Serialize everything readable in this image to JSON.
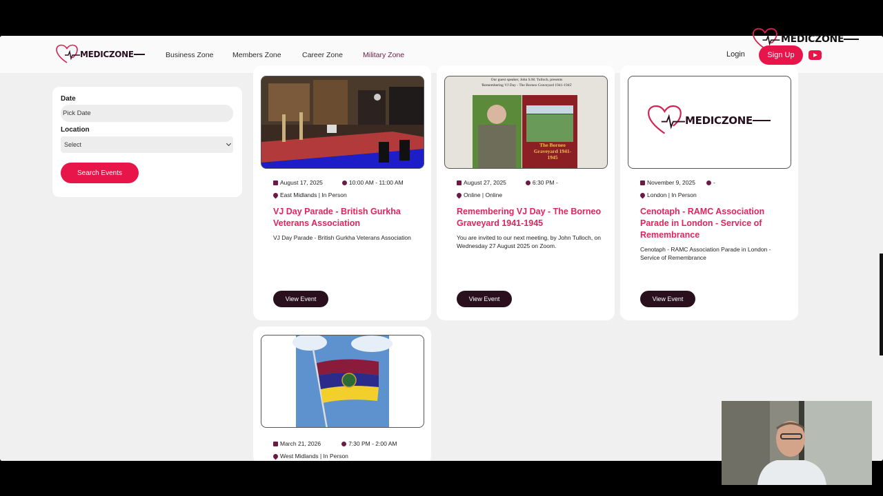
{
  "brand": {
    "name": "MEDICZONE"
  },
  "nav": {
    "items": [
      {
        "label": "Business Zone"
      },
      {
        "label": "Members Zone"
      },
      {
        "label": "Career Zone"
      },
      {
        "label": "Military Zone",
        "active": true
      }
    ],
    "login": "Login",
    "signup": "Sign Up",
    "youtube_icon": "youtube-icon"
  },
  "filters": {
    "date_label": "Date",
    "date_placeholder": "Pick Date",
    "location_label": "Location",
    "location_value": "Select",
    "search_button": "Search Events"
  },
  "events": [
    {
      "date": "August 17, 2025",
      "time": "10:00 AM - 11:00 AM",
      "location": "East Midlands | In Person",
      "title": "VJ Day Parade - British Gurkha Veterans Association",
      "description": "VJ Day Parade - British Gurkha Veterans Association",
      "button": "View Event"
    },
    {
      "date": "August 27, 2025",
      "time": "6:30 PM -",
      "location": "Online | Online",
      "title": "Remembering VJ Day - The Borneo Graveyard 1941-1945",
      "description": "You are invited to our next meeting, by John Tulloch, on Wednesday 27 August 2025 on Zoom.",
      "button": "View Event",
      "image_caption_1": "Our guest speaker, John S.M. Tulloch, presents",
      "image_caption_2": "'Remembering VJ Day - The Borneo Graveyard 1941-1945'",
      "book_title": "The Borneo Graveyard 1941-1945"
    },
    {
      "date": "November 9, 2025",
      "time": "-",
      "location": "London | In Person",
      "title": "Cenotaph - RAMC Association Parade in London - Service of Remembrance",
      "description": "Cenotaph - RAMC Association Parade in London - Service of Remembrance",
      "button": "View Event"
    },
    {
      "date": "March 21, 2026",
      "time": "7:30 PM - 2:00 AM",
      "location": "West Midlands | In Person"
    }
  ],
  "colors": {
    "accent": "#e8154a",
    "title_pink": "#e0245e",
    "dark_button": "#2a0f1d",
    "icon_maroon": "#6b1a46",
    "page_bg": "#f1f0f0"
  }
}
